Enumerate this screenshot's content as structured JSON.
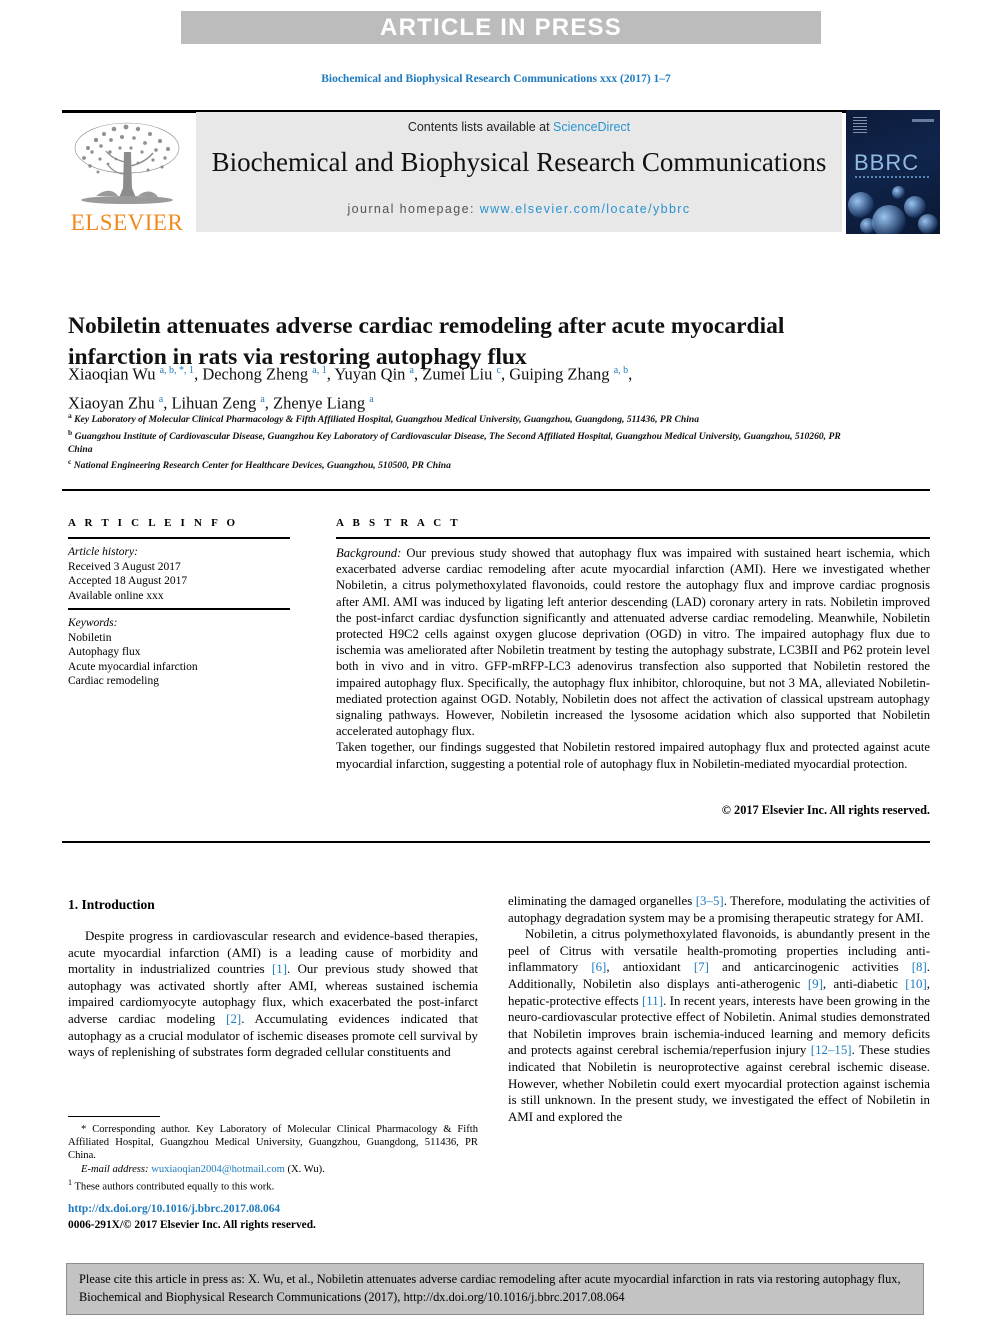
{
  "banner": {
    "text": "ARTICLE IN PRESS"
  },
  "running_head": {
    "text": "Biochemical and Biophysical Research Communications xxx (2017) 1–7"
  },
  "masthead": {
    "publisher": "ELSEVIER",
    "contents_prefix": "Contents lists available at ",
    "contents_link": "ScienceDirect",
    "journal_title": "Biochemical and Biophysical Research Communications",
    "homepage_prefix": "journal homepage: ",
    "homepage_url": "www.elsevier.com/locate/ybbrc",
    "cover_title": "BBRC"
  },
  "article": {
    "title": "Nobiletin attenuates adverse cardiac remodeling after acute myocardial infarction in rats via restoring autophagy flux",
    "authors_line_1": "Xiaoqian Wu a, b, *, 1, Dechong Zheng a, 1, Yuyan Qin a, Zumei Liu c, Guiping Zhang a, b,",
    "authors_line_2": "Xiaoyan Zhu a, Lihuan Zeng a, Zhenye Liang a",
    "affiliations": [
      {
        "mark": "a",
        "text": "Key Laboratory of Molecular Clinical Pharmacology & Fifth Affiliated Hospital, Guangzhou Medical University, Guangzhou, Guangdong, 511436, PR China"
      },
      {
        "mark": "b",
        "text": "Guangzhou Institute of Cardiovascular Disease, Guangzhou Key Laboratory of Cardiovascular Disease, The Second Affiliated Hospital, Guangzhou Medical University, Guangzhou, 510260, PR China"
      },
      {
        "mark": "c",
        "text": "National Engineering Research Center for Healthcare Devices, Guangzhou, 510500, PR China"
      }
    ]
  },
  "info": {
    "heading": "A R T I C L E   I N F O",
    "history_label": "Article history:",
    "history": [
      "Received 3 August 2017",
      "Accepted 18 August 2017",
      "Available online xxx"
    ],
    "keywords_label": "Keywords:",
    "keywords": [
      "Nobiletin",
      "Autophagy flux",
      "Acute myocardial infarction",
      "Cardiac remodeling"
    ]
  },
  "abstract": {
    "heading": "A B S T R A C T",
    "lead_label": "Background:",
    "paragraph_1": " Our previous study showed that autophagy flux was impaired with sustained heart ischemia, which exacerbated adverse cardiac remodeling after acute myocardial infarction (AMI). Here we investigated whether Nobiletin, a citrus polymethoxylated flavonoids, could restore the autophagy flux and improve cardiac prognosis after AMI. AMI was induced by ligating left anterior descending (LAD) coronary artery in rats. Nobiletin improved the post-infarct cardiac dysfunction significantly and attenuated adverse cardiac remodeling. Meanwhile, Nobiletin protected H9C2 cells against oxygen glucose deprivation (OGD) in vitro. The impaired autophagy flux due to ischemia was ameliorated after Nobiletin treatment by testing the autophagy substrate, LC3BII and P62 protein level both in vivo and in vitro. GFP-mRFP-LC3 adenovirus transfection also supported that Nobiletin restored the impaired autophagy flux. Specifically, the autophagy flux inhibitor, chloroquine, but not 3 MA, alleviated Nobiletin-mediated protection against OGD. Notably, Nobiletin does not affect the activation of classical upstream autophagy signaling pathways. However, Nobiletin increased the lysosome acidation which also supported that Nobiletin accelerated autophagy flux.",
    "paragraph_2": "Taken together, our findings suggested that Nobiletin restored impaired autophagy flux and protected against acute myocardial infarction, suggesting a potential role of autophagy flux in Nobiletin-mediated myocardial protection.",
    "copyright": "© 2017 Elsevier Inc. All rights reserved."
  },
  "body": {
    "section_number_title": "1.  Introduction",
    "left_paragraph": "Despite progress in cardiovascular research and evidence-based therapies, acute myocardial infarction (AMI) is a leading cause of morbidity and mortality in industrialized countries [1]. Our previous study showed that autophagy was activated shortly after AMI, whereas sustained ischemia impaired cardiomyocyte autophagy flux, which exacerbated the post-infarct adverse cardiac modeling [2]. Accumulating evidences indicated that autophagy as a crucial modulator of ischemic diseases promote cell survival by ways of replenishing of substrates form degraded cellular constituents and",
    "right_paragraph_1": "eliminating the damaged organelles [3–5]. Therefore, modulating the activities of autophagy degradation system may be a promising therapeutic strategy for AMI.",
    "right_paragraph_2": "Nobiletin, a citrus polymethoxylated flavonoids, is abundantly present in the peel of Citrus with versatile health-promoting properties including anti-inflammatory [6], antioxidant [7] and anticarcinogenic activities [8]. Additionally, Nobiletin also displays anti-atherogenic [9], anti-diabetic [10], hepatic-protective effects [11]. In recent years, interests have been growing in the neuro-cardiovascular protective effect of Nobiletin. Animal studies demonstrated that Nobiletin improves brain ischemia-induced learning and memory deficits and protects against cerebral ischemia/reperfusion injury [12–15]. These studies indicated that Nobiletin is neuroprotective against cerebral ischemic disease. However, whether Nobiletin could exert myocardial protection against ischemia is still unknown. In the present study, we investigated the effect of Nobiletin in AMI and explored the"
  },
  "footnotes": {
    "corresponding": "* Corresponding author. Key Laboratory of Molecular Clinical Pharmacology & Fifth Affiliated Hospital, Guangzhou Medical University, Guangzhou, Guangdong, 511436, PR China.",
    "email_label": "E-mail address:",
    "email": "wuxiaoqian2004@hotmail.com",
    "email_suffix": " (X. Wu).",
    "equal_contribution_mark": "1",
    "equal_contribution": " These authors contributed equally to this work.",
    "doi": "http://dx.doi.org/10.1016/j.bbrc.2017.08.064",
    "issn_copyright": "0006-291X/© 2017 Elsevier Inc. All rights reserved."
  },
  "citation_box": {
    "text": "Please cite this article in press as: X. Wu, et al., Nobiletin attenuates adverse cardiac remodeling after acute myocardial infarction in rats via restoring autophagy flux, Biochemical and Biophysical Research Communications (2017), http://dx.doi.org/10.1016/j.bbrc.2017.08.064"
  },
  "colors": {
    "link": "#1f7bbf",
    "banner_bg": "#bcbcbc",
    "masthead_bg": "#e8e8e8",
    "elsevier_orange": "#f08a1e",
    "cite_box_bg": "#c3c3c3"
  }
}
